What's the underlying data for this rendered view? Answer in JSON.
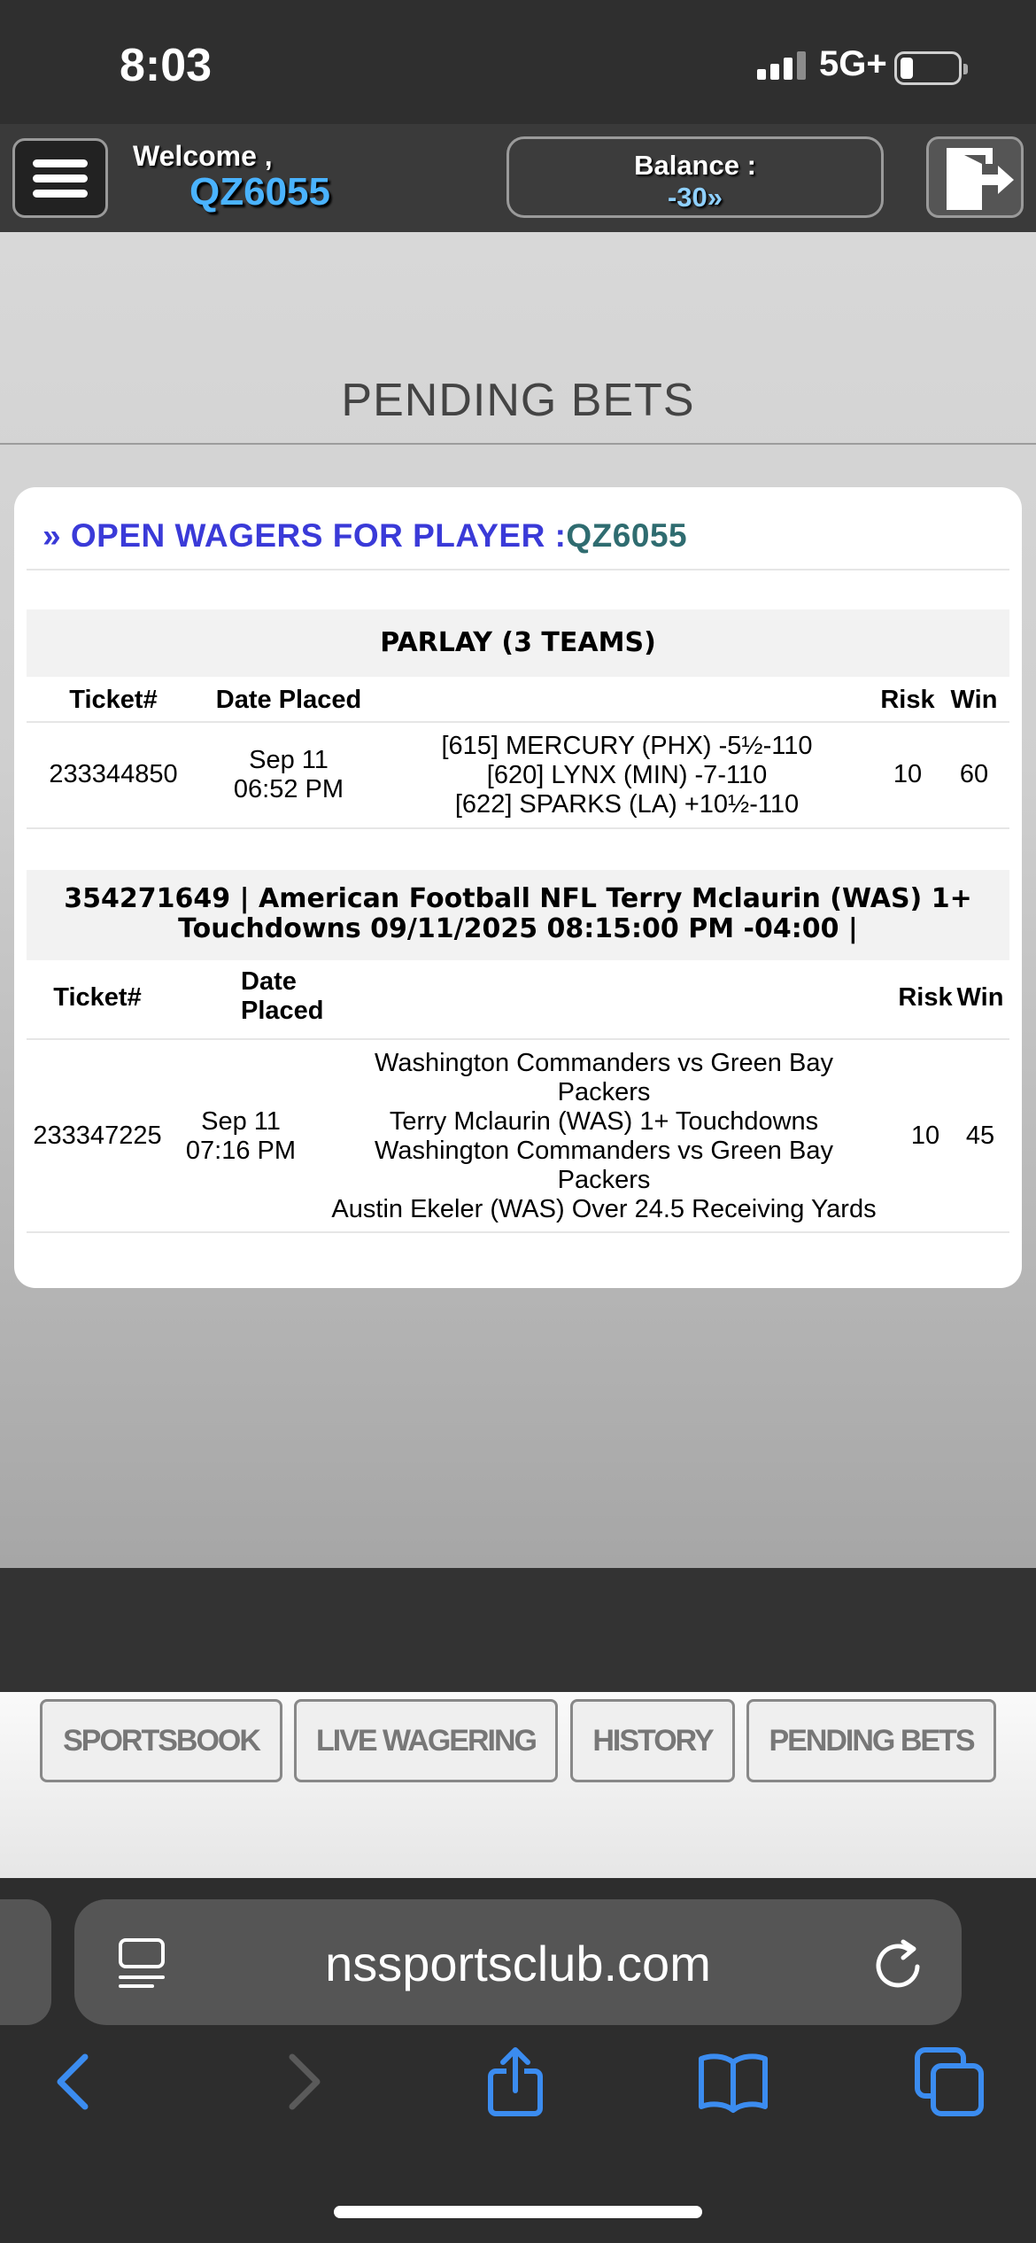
{
  "status_bar": {
    "time": "8:03",
    "network": "5G+",
    "battery_level": 0.2
  },
  "header": {
    "welcome_label": "Welcome ,",
    "username": "QZ6055",
    "balance_label": "Balance :",
    "balance_value": "-30»",
    "menu_icon": "hamburger-menu-icon",
    "logout_icon": "logout-icon"
  },
  "page": {
    "title": "PENDING BETS"
  },
  "open_wagers": {
    "heading_prefix": "» OPEN WAGERS FOR PLAYER :",
    "player": "QZ6055"
  },
  "bets": [
    {
      "title_lines": [
        "PARLAY (3 TEAMS)"
      ],
      "columns": {
        "ticket": "Ticket#",
        "date": "Date Placed",
        "risk": "Risk",
        "win": "Win"
      },
      "ticket": "233344850",
      "date": "Sep 11",
      "time": "06:52 PM",
      "details": [
        "[615] MERCURY (PHX) -5½-110",
        "[620] LYNX (MIN) -7-110",
        "[622] SPARKS (LA) +10½-110"
      ],
      "risk": "10",
      "win": "60"
    },
    {
      "title_lines": [
        "354271649 | American Football NFL Terry Mclaurin (WAS) 1+",
        "Touchdowns 09/11/2025 08:15:00 PM -04:00 |"
      ],
      "columns": {
        "ticket": "Ticket#",
        "date_line1": "Date",
        "date_line2": "Placed",
        "risk": "Risk",
        "win": "Win"
      },
      "ticket": "233347225",
      "date": "Sep 11",
      "time": "07:16 PM",
      "details": [
        "Washington Commanders vs Green Bay",
        "Packers",
        "Terry Mclaurin (WAS) 1+ Touchdowns",
        "Washington Commanders vs Green Bay",
        "Packers",
        "Austin Ekeler (WAS) Over 24.5 Receiving Yards"
      ],
      "risk": "10",
      "win": "45"
    }
  ],
  "nav_tabs": [
    "SPORTSBOOK",
    "LIVE WAGERING",
    "HISTORY",
    "PENDING BETS"
  ],
  "browser": {
    "url": "nssportsclub.com",
    "icons": [
      "reader-mode-icon",
      "reload-icon",
      "back-icon",
      "forward-icon",
      "share-icon",
      "bookmarks-icon",
      "tabs-icon"
    ]
  }
}
